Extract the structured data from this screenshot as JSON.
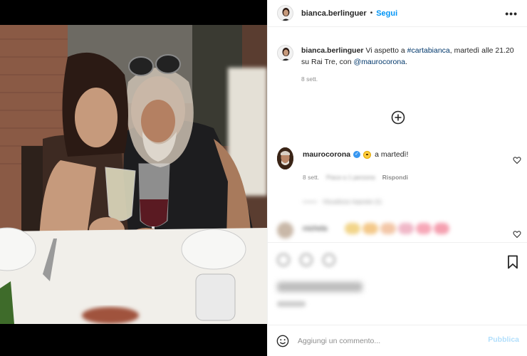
{
  "header": {
    "username": "bianca.berlinguer",
    "separator": "•",
    "follow_label": "Segui",
    "more_label": "•••"
  },
  "caption": {
    "username": "bianca.berlinguer",
    "text_before_tag": " Vi aspetto a ",
    "hashtag": "#cartabianca",
    "text_after_tag": ", martedì alle 21.20 su Rai Tre, con ",
    "mention": "@maurocorona",
    "end": ".",
    "time": "8 sett."
  },
  "comment": {
    "username": "maurocorona",
    "verified_mark": "✓",
    "text": "a martedì!",
    "time": "8 sett.",
    "likes": "Piace a 1 persona",
    "reply_label": "Rispondi",
    "thread_label": "Visualizza risposte (1)"
  },
  "blurred_comment": {
    "username": "michela"
  },
  "composer": {
    "placeholder": "Aggiungi un commento...",
    "publish_label": "Pubblica"
  },
  "colors": {
    "link": "#00376b",
    "follow": "#0095f6",
    "publish_disabled": "#b2dffc",
    "secondary_text": "#8e8e8e"
  },
  "icons": {
    "more": "more-horizontal-icon",
    "add": "plus-circle-icon",
    "heart": "heart-outline-icon",
    "bookmark": "bookmark-icon",
    "emoji": "emoji-smile-icon",
    "verified": "verified-badge-icon"
  }
}
